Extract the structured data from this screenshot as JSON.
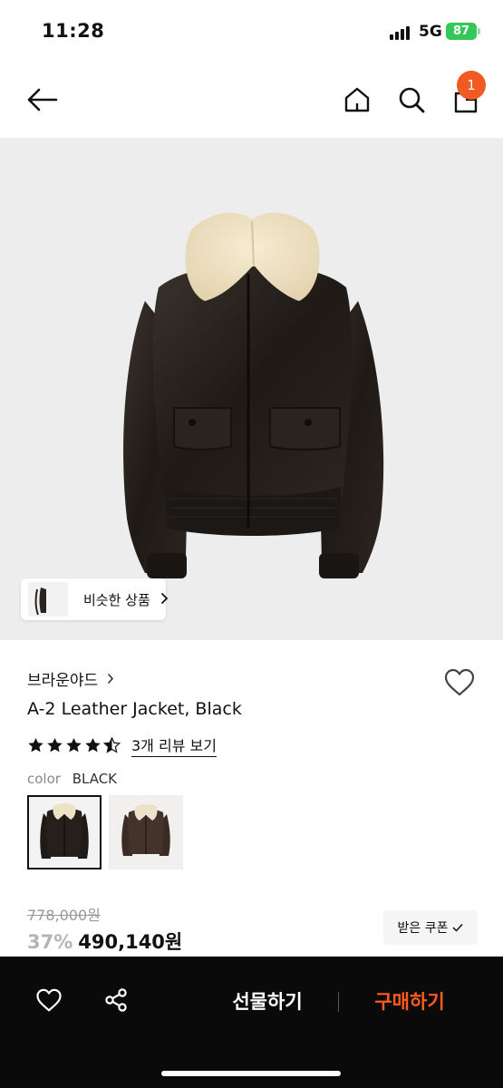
{
  "status_bar": {
    "time": "11:28",
    "network": "5G",
    "battery": "87"
  },
  "nav": {
    "cart_count": "1",
    "icons": [
      "back-arrow-icon",
      "home-icon",
      "search-icon",
      "shopping-bag-icon"
    ]
  },
  "product": {
    "similar_label": "비슷한 상품",
    "brand": "브라운야드",
    "name": "A-2 Leather Jacket, Black",
    "rating": 4.5,
    "review_link": "3개 리뷰 보기",
    "color_label": "color",
    "color_value": "BLACK",
    "swatches": [
      "black",
      "brown"
    ],
    "original_price": "778,000원",
    "discount": "37%",
    "sale_price": "490,140원",
    "coupon_label": "받은 쿠폰"
  },
  "bottom_bar": {
    "gift_label": "선물하기",
    "buy_label": "구매하기"
  },
  "colors": {
    "accent": "#f15a22",
    "buy_text": "#ff5a1f",
    "bottom_bar_bg": "#0a0a0a"
  }
}
